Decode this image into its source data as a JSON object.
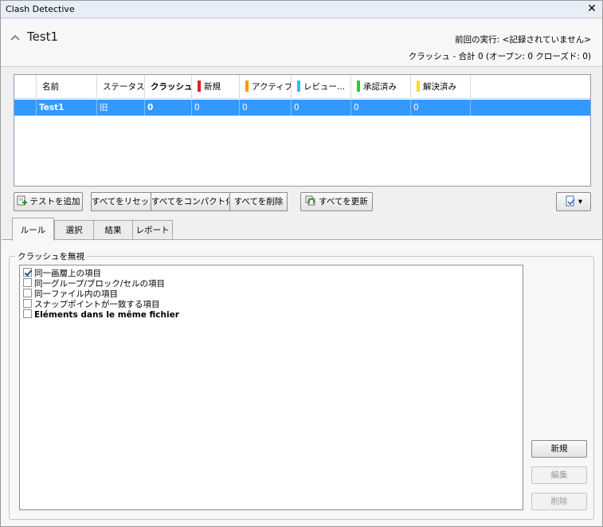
{
  "window": {
    "title": "Clash Detective",
    "close_glyph": "✕"
  },
  "header": {
    "test_name": "Test1",
    "last_run": "前回の実行: <記録されていません>",
    "summary": "クラッシュ - 合計 0 (オープン: 0 クローズド: 0)"
  },
  "grid": {
    "columns": [
      {
        "label": "名前"
      },
      {
        "label": "ステータス"
      },
      {
        "label": "クラッシュ"
      },
      {
        "label": "新規",
        "color": "#e02020"
      },
      {
        "label": "アクティブ",
        "color": "#ff9a00"
      },
      {
        "label": "レビュー...",
        "color": "#22c3f0"
      },
      {
        "label": "承認済み",
        "color": "#22d022"
      },
      {
        "label": "解決済み",
        "color": "#f0e020"
      }
    ],
    "rows": [
      {
        "name": "Test1",
        "status": "旧",
        "clashes": "0",
        "new": "0",
        "active": "0",
        "reviewed": "0",
        "approved": "0",
        "resolved": "0"
      }
    ],
    "selection_color": "#3399ff"
  },
  "toolbar": {
    "add_test": "テストを追加",
    "reset_all": "すべてをリセット",
    "compact_all": "すべてをコンパクト化",
    "delete_all": "すべてを削除",
    "update_all": "すべてを更新",
    "dropdown_glyph": "▾"
  },
  "tabs": [
    {
      "label": "ルール",
      "active": true
    },
    {
      "label": "選択",
      "active": false
    },
    {
      "label": "結果",
      "active": false
    },
    {
      "label": "レポート",
      "active": false
    }
  ],
  "rules": {
    "group_title": "クラッシュを無視",
    "items": [
      {
        "label": "同一画層上の項目",
        "checked": true
      },
      {
        "label": "同一グループ/ブロック/セルの項目",
        "checked": false
      },
      {
        "label": "同一ファイル内の項目",
        "checked": false
      },
      {
        "label": "スナップポイントが一致する項目",
        "checked": false
      },
      {
        "label": "Eléments dans le même fichier",
        "checked": false
      }
    ],
    "buttons": {
      "new": "新規",
      "edit": "編集",
      "delete": "削除"
    }
  }
}
